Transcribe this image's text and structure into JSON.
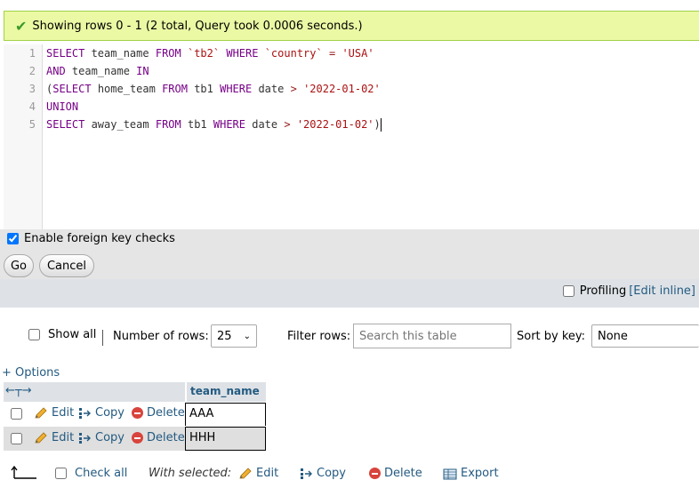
{
  "message": {
    "text": "Showing rows 0 - 1 (2 total, Query took 0.0006 seconds.)"
  },
  "editor": {
    "lines": [
      {
        "num": "1",
        "tokens": [
          {
            "t": "SELECT",
            "c": "kw"
          },
          {
            "t": " team_name ",
            "c": ""
          },
          {
            "t": "FROM",
            "c": "kw"
          },
          {
            "t": " ",
            "c": ""
          },
          {
            "t": "`tb2`",
            "c": "bt"
          },
          {
            "t": " ",
            "c": ""
          },
          {
            "t": "WHERE",
            "c": "kw"
          },
          {
            "t": " ",
            "c": ""
          },
          {
            "t": "`country`",
            "c": "bt"
          },
          {
            "t": " ",
            "c": ""
          },
          {
            "t": "=",
            "c": "op"
          },
          {
            "t": " ",
            "c": ""
          },
          {
            "t": "'USA'",
            "c": "str"
          }
        ]
      },
      {
        "num": "2",
        "tokens": [
          {
            "t": "AND",
            "c": "kw"
          },
          {
            "t": " team_name ",
            "c": ""
          },
          {
            "t": "IN",
            "c": "kw"
          }
        ]
      },
      {
        "num": "3",
        "tokens": [
          {
            "t": "(",
            "c": ""
          },
          {
            "t": "SELECT",
            "c": "kw"
          },
          {
            "t": " home_team ",
            "c": ""
          },
          {
            "t": "FROM",
            "c": "kw"
          },
          {
            "t": " tb1 ",
            "c": ""
          },
          {
            "t": "WHERE",
            "c": "kw"
          },
          {
            "t": " date ",
            "c": ""
          },
          {
            "t": ">",
            "c": "op"
          },
          {
            "t": " ",
            "c": ""
          },
          {
            "t": "'2022-01-02'",
            "c": "str"
          }
        ]
      },
      {
        "num": "4",
        "tokens": [
          {
            "t": "UNION",
            "c": "kw"
          }
        ]
      },
      {
        "num": "5",
        "tokens": [
          {
            "t": "SELECT",
            "c": "kw"
          },
          {
            "t": " away_team ",
            "c": ""
          },
          {
            "t": "FROM",
            "c": "kw"
          },
          {
            "t": " tb1 ",
            "c": ""
          },
          {
            "t": "WHERE",
            "c": "kw"
          },
          {
            "t": " date ",
            "c": ""
          },
          {
            "t": ">",
            "c": "op"
          },
          {
            "t": " ",
            "c": ""
          },
          {
            "t": "'2022-01-02'",
            "c": "str"
          },
          {
            "t": ")",
            "c": ""
          }
        ]
      }
    ]
  },
  "options": {
    "foreign_key_label": "Enable foreign key checks",
    "foreign_key_checked": true,
    "go_label": "Go",
    "cancel_label": "Cancel",
    "profiling_label": "Profiling",
    "edit_inline_label": "[Edit inline]"
  },
  "nav": {
    "show_all_label": "Show all",
    "rows_label": "Number of rows:",
    "rows_value": "25",
    "filter_label": "Filter rows:",
    "filter_placeholder": "Search this table",
    "sort_label": "Sort by key:",
    "sort_value": "None"
  },
  "results": {
    "options_link": "+ Options",
    "column_header": "team_name",
    "row_actions": {
      "edit": "Edit",
      "copy": "Copy",
      "delete": "Delete"
    },
    "rows": [
      "AAA",
      "HHH"
    ]
  },
  "bulk": {
    "check_all_label": "Check all",
    "with_selected_label": "With selected:",
    "edit_label": "Edit",
    "copy_label": "Copy",
    "delete_label": "Delete",
    "export_label": "Export"
  },
  "colors": {
    "success_bg": "#ebf8a4",
    "link": "#235a81",
    "header_bg": "#dee2e6"
  }
}
